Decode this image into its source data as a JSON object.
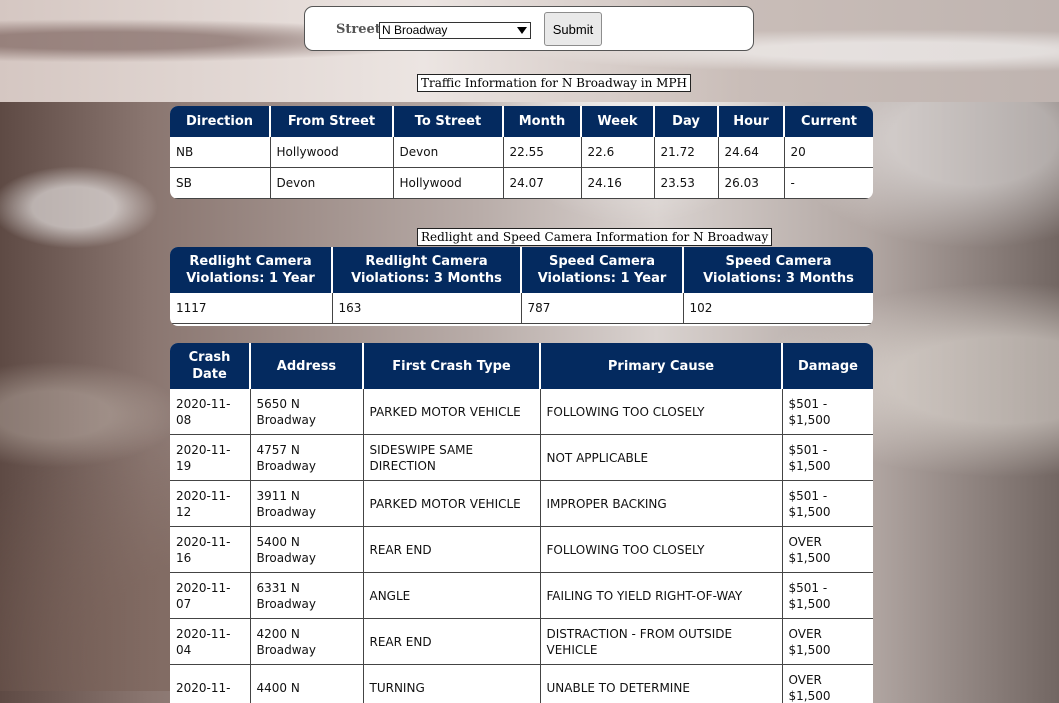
{
  "form": {
    "street_label": "Street:",
    "street_value": "N Broadway",
    "submit_label": "Submit"
  },
  "traffic": {
    "caption": "Traffic Information for N Broadway in MPH",
    "headers": [
      "Direction",
      "From Street",
      "To Street",
      "Month",
      "Week",
      "Day",
      "Hour",
      "Current"
    ],
    "rows": [
      [
        "NB",
        "Hollywood",
        "Devon",
        "22.55",
        "22.6",
        "21.72",
        "24.64",
        "20"
      ],
      [
        "SB",
        "Devon",
        "Hollywood",
        "24.07",
        "24.16",
        "23.53",
        "26.03",
        "-"
      ]
    ]
  },
  "camera": {
    "caption": "Redlight and Speed Camera Information for N Broadway",
    "headers": [
      "Redlight Camera Violations: 1 Year",
      "Redlight Camera Violations: 3 Months",
      "Speed Camera Violations: 1 Year",
      "Speed Camera Violations: 3 Months"
    ],
    "rows": [
      [
        "1117",
        "163",
        "787",
        "102"
      ]
    ]
  },
  "crashes": {
    "headers": [
      "Crash Date",
      "Address",
      "First Crash Type",
      "Primary Cause",
      "Damage"
    ],
    "rows": [
      [
        "2020-11-08",
        "5650 N Broadway",
        "PARKED MOTOR VEHICLE",
        "FOLLOWING TOO CLOSELY",
        "$501 - $1,500"
      ],
      [
        "2020-11-19",
        "4757 N Broadway",
        "SIDESWIPE SAME DIRECTION",
        "NOT APPLICABLE",
        "$501 - $1,500"
      ],
      [
        "2020-11-12",
        "3911 N Broadway",
        "PARKED MOTOR VEHICLE",
        "IMPROPER BACKING",
        "$501 - $1,500"
      ],
      [
        "2020-11-16",
        "5400 N Broadway",
        "REAR END",
        "FOLLOWING TOO CLOSELY",
        "OVER $1,500"
      ],
      [
        "2020-11-07",
        "6331 N Broadway",
        "ANGLE",
        "FAILING TO YIELD RIGHT-OF-WAY",
        "$501 - $1,500"
      ],
      [
        "2020-11-04",
        "4200 N Broadway",
        "REAR END",
        "DISTRACTION - FROM OUTSIDE VEHICLE",
        "OVER $1,500"
      ],
      [
        "2020-11-",
        "4400 N",
        "TURNING",
        "UNABLE TO DETERMINE",
        "OVER $1,500"
      ]
    ]
  },
  "colors": {
    "header_bg": "#042a5f",
    "header_text": "#ffffff"
  }
}
